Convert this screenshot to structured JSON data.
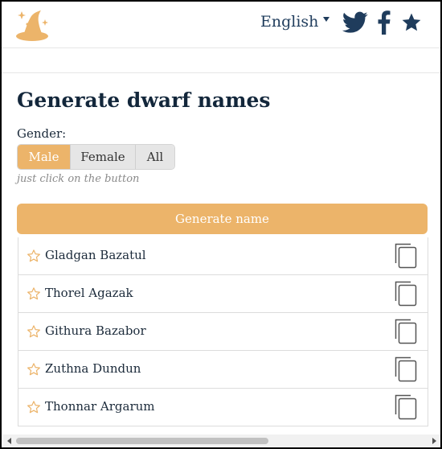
{
  "header": {
    "language": "English",
    "icons": [
      "wizard-hat-logo-icon",
      "twitter-icon",
      "facebook-icon",
      "star-icon"
    ]
  },
  "main": {
    "title": "Generate dwarf names",
    "gender_label": "Gender:",
    "gender_options": [
      "Male",
      "Female",
      "All"
    ],
    "selected_gender": "Male",
    "hint": "just click on the button",
    "generate_label": "Generate name"
  },
  "names": [
    "Gladgan Bazatul",
    "Thorel Agazak",
    "Githura Bazabor",
    "Zuthna Dundun",
    "Thonnar Argarum"
  ],
  "colors": {
    "accent": "#ecb46a",
    "brand_dark": "#1f3c5c",
    "text": "#1b2a3a",
    "muted": "#8a8a8a"
  }
}
